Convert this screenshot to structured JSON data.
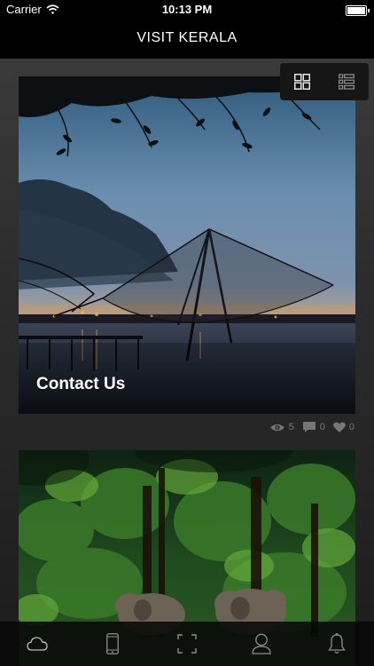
{
  "status_bar": {
    "carrier": "Carrier",
    "time": "10:13 PM",
    "battery_level": 1.0
  },
  "nav": {
    "title": "VISIT KERALA"
  },
  "view_toggle": {
    "options": [
      "grid-icon",
      "list-icon"
    ],
    "selected": "grid"
  },
  "cards": [
    {
      "title": "Contact Us",
      "image": "kochi-fishing-nets-at-dusk",
      "views": "5",
      "comments": "0",
      "likes": "0"
    },
    {
      "title": "",
      "image": "elephants-in-forest"
    }
  ],
  "tab_bar": {
    "tabs": [
      "cloud-icon",
      "phone-icon",
      "scan-icon",
      "profile-icon",
      "bell-icon"
    ]
  }
}
